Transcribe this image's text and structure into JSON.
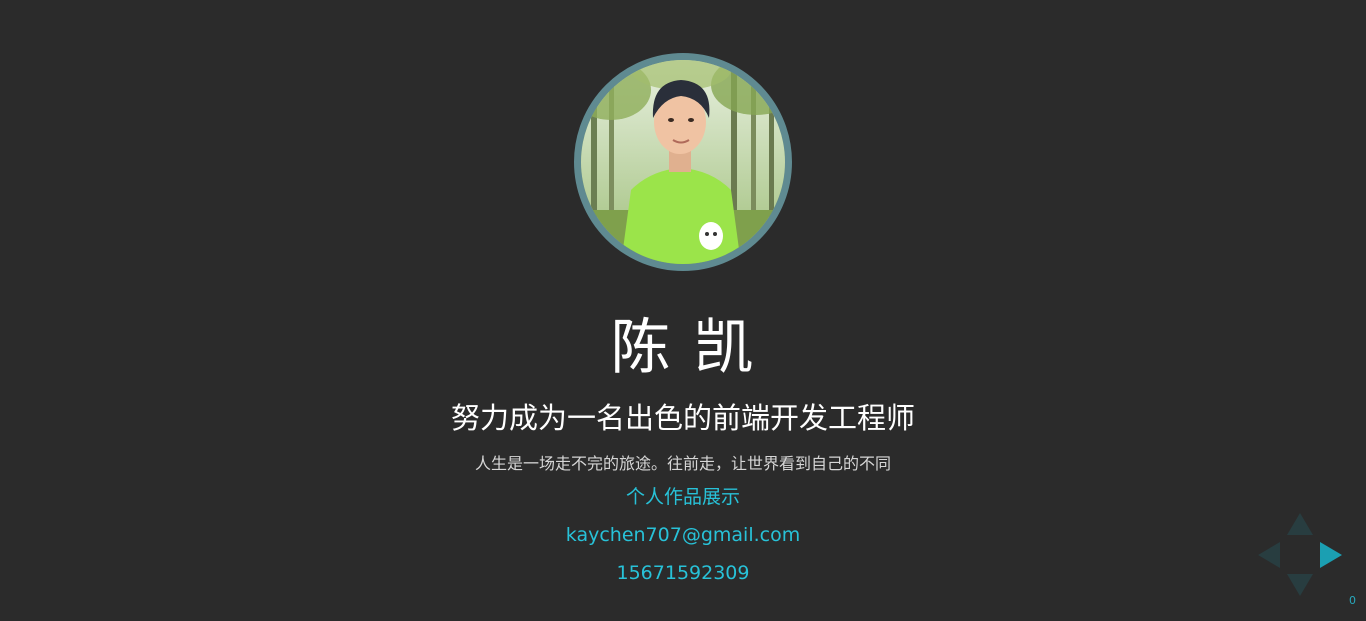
{
  "profile": {
    "name": "陈 凯",
    "subtitle": "努力成为一名出色的前端开发工程师",
    "motto": "人生是一场走不完的旅途。往前走，让世界看到自己的不同",
    "portfolio_link": "个人作品展示",
    "email": "kaychen707@gmail.com",
    "phone": "15671592309"
  },
  "navigation": {
    "slide_number": "0",
    "icons": [
      "nav-up-icon",
      "nav-down-icon",
      "nav-left-icon",
      "nav-right-icon"
    ]
  },
  "colors": {
    "background": "#2b2b2b",
    "accent": "#28c2d8",
    "avatar_border": "#5f8a91",
    "control_active": "#1b9fb2",
    "control_inactive": "#283d40"
  }
}
